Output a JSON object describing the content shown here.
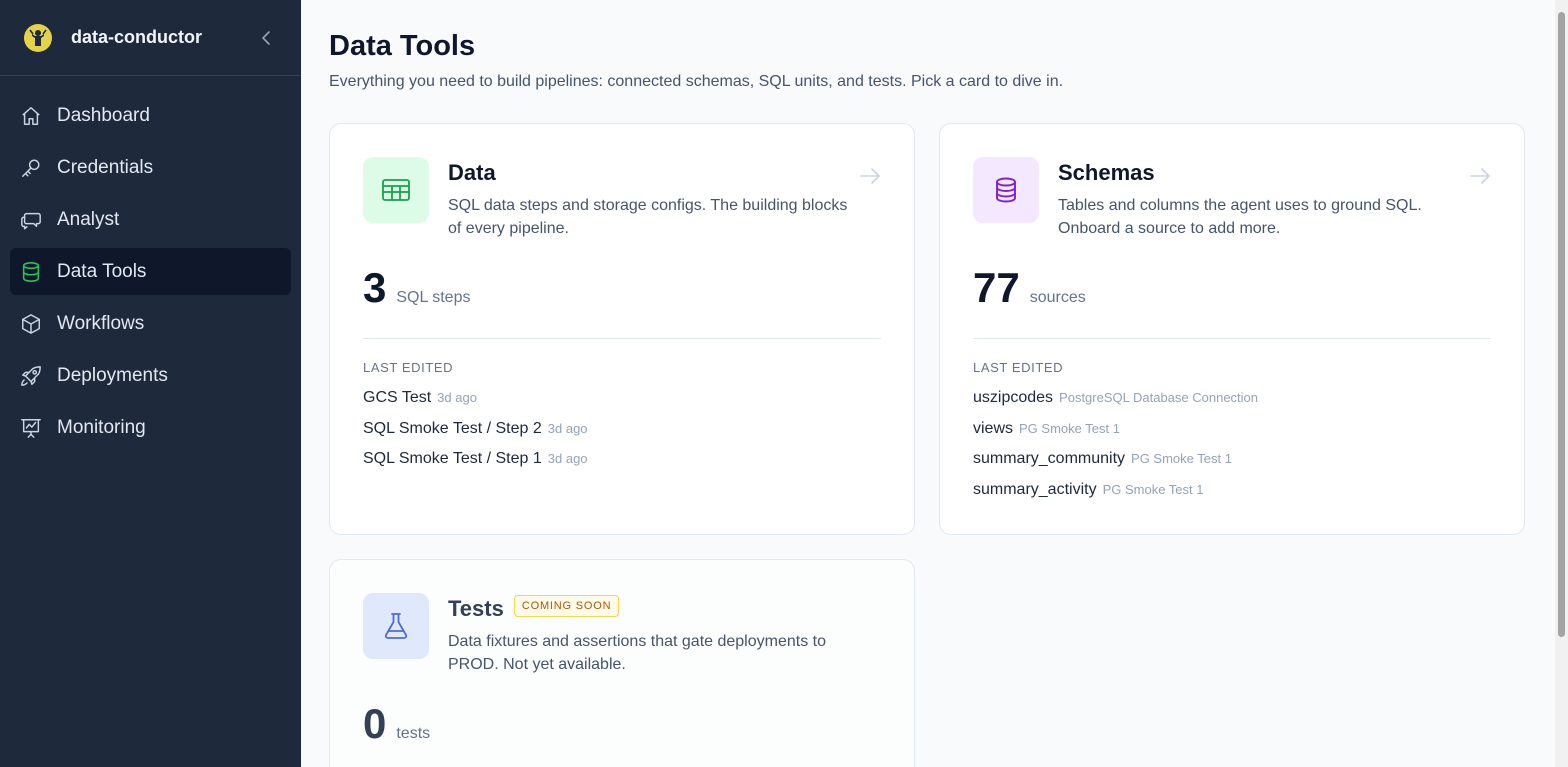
{
  "app": {
    "name": "data-conductor"
  },
  "sidebar": {
    "items": [
      {
        "label": "Dashboard",
        "icon": "home-icon"
      },
      {
        "label": "Credentials",
        "icon": "key-icon"
      },
      {
        "label": "Analyst",
        "icon": "chat-icon"
      },
      {
        "label": "Data Tools",
        "icon": "database-icon",
        "active": true
      },
      {
        "label": "Workflows",
        "icon": "cube-icon"
      },
      {
        "label": "Deployments",
        "icon": "rocket-icon"
      },
      {
        "label": "Monitoring",
        "icon": "chart-board-icon"
      }
    ]
  },
  "page": {
    "title": "Data Tools",
    "subtitle": "Everything you need to build pipelines: connected schemas, SQL units, and tests. Pick a card to dive in."
  },
  "cards": {
    "data": {
      "title": "Data",
      "description": "SQL data steps and storage configs. The building blocks of every pipeline.",
      "count": "3",
      "unit": "SQL steps",
      "last_label": "LAST EDITED",
      "recent": [
        {
          "name": "GCS Test",
          "meta": "3d ago"
        },
        {
          "name": "SQL Smoke Test / Step 2",
          "meta": "3d ago"
        },
        {
          "name": "SQL Smoke Test / Step 1",
          "meta": "3d ago"
        }
      ]
    },
    "schemas": {
      "title": "Schemas",
      "description": "Tables and columns the agent uses to ground SQL. Onboard a source to add more.",
      "count": "77",
      "unit": "sources",
      "last_label": "LAST EDITED",
      "recent": [
        {
          "name": "uszipcodes",
          "meta": "PostgreSQL Database Connection"
        },
        {
          "name": "views",
          "meta": "PG Smoke Test 1"
        },
        {
          "name": "summary_community",
          "meta": "PG Smoke Test 1"
        },
        {
          "name": "summary_activity",
          "meta": "PG Smoke Test 1"
        }
      ]
    },
    "tests": {
      "title": "Tests",
      "badge": "COMING SOON",
      "description": "Data fixtures and assertions that gate deployments to PROD. Not yet available.",
      "count": "0",
      "unit": "tests"
    }
  },
  "colors": {
    "sidebar_bg": "#1e293b",
    "active_item_bg": "#0f172a",
    "data_accent": "#16a34a",
    "schemas_accent": "#7e22ce",
    "tests_accent": "#4f6bd8",
    "badge_text": "#b45309"
  }
}
